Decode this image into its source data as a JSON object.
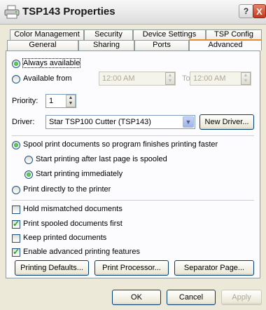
{
  "window": {
    "title": "TSP143 Properties",
    "help_glyph": "?",
    "close_glyph": "X"
  },
  "tabs": {
    "row1": [
      "Color Management",
      "Security",
      "Device Settings",
      "TSP Config"
    ],
    "row2": [
      "General",
      "Sharing",
      "Ports",
      "Advanced"
    ],
    "selected": "Advanced"
  },
  "availability": {
    "always_label": "Always available",
    "from_label": "Available from",
    "from_time": "12:00 AM",
    "to_label": "To",
    "to_time": "12:00 AM",
    "selected": "always"
  },
  "priority": {
    "label": "Priority:",
    "value": "1"
  },
  "driver": {
    "label": "Driver:",
    "value": "Star TSP100 Cutter (TSP143)",
    "new_driver_label": "New Driver..."
  },
  "spool": {
    "spool_label": "Spool print documents so program finishes printing faster",
    "after_last_label": "Start printing after last page is spooled",
    "immediately_label": "Start printing immediately",
    "direct_label": "Print directly to the printer"
  },
  "options": {
    "hold_mismatched": {
      "label": "Hold mismatched documents",
      "checked": false
    },
    "print_spooled_first": {
      "label": "Print spooled documents first",
      "checked": true
    },
    "keep_printed": {
      "label": "Keep printed documents",
      "checked": false
    },
    "enable_advanced": {
      "label": "Enable advanced printing features",
      "checked": true
    }
  },
  "panel_buttons": {
    "printing_defaults": "Printing Defaults...",
    "print_processor": "Print Processor...",
    "separator_page": "Separator Page..."
  },
  "dialog_buttons": {
    "ok": "OK",
    "cancel": "Cancel",
    "apply": "Apply"
  },
  "icons": {
    "title": "printer-icon",
    "spin": "spinner-arrows-icon",
    "dropdown": "chevron-down-icon"
  }
}
